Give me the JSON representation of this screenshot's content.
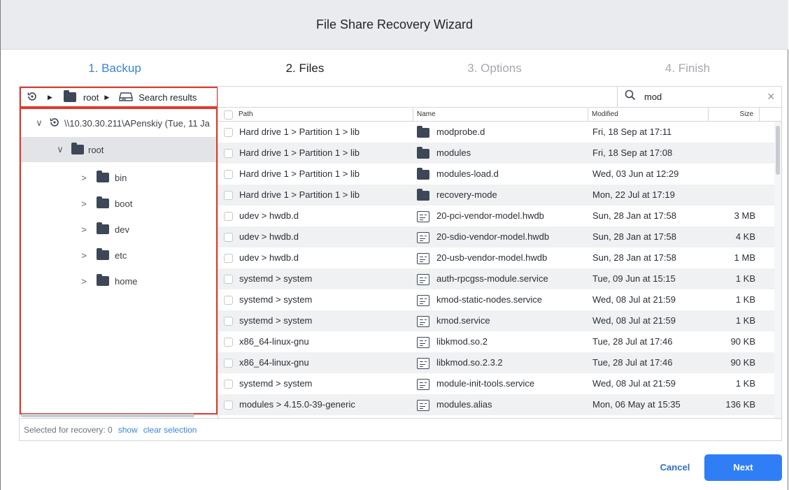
{
  "window": {
    "title": "File Share Recovery Wizard"
  },
  "steps": [
    {
      "label": "1. Backup",
      "state": "done"
    },
    {
      "label": "2. Files",
      "state": "current"
    },
    {
      "label": "3. Options",
      "state": "upcoming"
    },
    {
      "label": "4. Finish",
      "state": "upcoming"
    }
  ],
  "breadcrumb": {
    "items": [
      "root",
      "Search results"
    ],
    "icons": [
      "backup-restore-icon",
      "folder-icon",
      "drive-icon"
    ]
  },
  "tree": {
    "root_label": "\\\\10.30.30.211\\APenskiy (Tue, 11 Ja",
    "selected": "root",
    "root_folder": "root",
    "children": [
      "bin",
      "boot",
      "dev",
      "etc",
      "home"
    ]
  },
  "search": {
    "value": "mod",
    "icon": "search-icon",
    "clear_icon": "close-icon"
  },
  "table": {
    "columns": [
      "Path",
      "Name",
      "Modified",
      "Size"
    ],
    "rows": [
      {
        "path": "Hard drive 1 > Partition 1 > lib",
        "name": "modprobe.d",
        "type": "folder",
        "modified": "Fri, 18 Sep at 17:11",
        "size": ""
      },
      {
        "path": "Hard drive 1 > Partition 1 > lib",
        "name": "modules",
        "type": "folder",
        "modified": "Fri, 18 Sep at 17:08",
        "size": ""
      },
      {
        "path": "Hard drive 1 > Partition 1 > lib",
        "name": "modules-load.d",
        "type": "folder",
        "modified": "Wed, 03 Jun at 12:29",
        "size": ""
      },
      {
        "path": "Hard drive 1 > Partition 1 > lib",
        "name": "recovery-mode",
        "type": "folder",
        "modified": "Mon, 22 Jul at 17:19",
        "size": ""
      },
      {
        "path": "udev > hwdb.d",
        "name": "20-pci-vendor-model.hwdb",
        "type": "file",
        "modified": "Sun, 28 Jan at 17:58",
        "size": "3 MB"
      },
      {
        "path": "udev > hwdb.d",
        "name": "20-sdio-vendor-model.hwdb",
        "type": "file",
        "modified": "Sun, 28 Jan at 17:58",
        "size": "4 KB"
      },
      {
        "path": "udev > hwdb.d",
        "name": "20-usb-vendor-model.hwdb",
        "type": "file",
        "modified": "Sun, 28 Jan at 17:58",
        "size": "1 MB"
      },
      {
        "path": "systemd > system",
        "name": "auth-rpcgss-module.service",
        "type": "file",
        "modified": "Tue, 09 Jun at 15:15",
        "size": "1 KB"
      },
      {
        "path": "systemd > system",
        "name": "kmod-static-nodes.service",
        "type": "file",
        "modified": "Wed, 08 Jul at 21:59",
        "size": "1 KB"
      },
      {
        "path": "systemd > system",
        "name": "kmod.service",
        "type": "file",
        "modified": "Wed, 08 Jul at 21:59",
        "size": "1 KB"
      },
      {
        "path": "x86_64-linux-gnu",
        "name": "libkmod.so.2",
        "type": "file",
        "modified": "Tue, 28 Jul at 17:46",
        "size": "90 KB"
      },
      {
        "path": "x86_64-linux-gnu",
        "name": "libkmod.so.2.3.2",
        "type": "file",
        "modified": "Tue, 28 Jul at 17:46",
        "size": "90 KB"
      },
      {
        "path": "systemd > system",
        "name": "module-init-tools.service",
        "type": "file",
        "modified": "Wed, 08 Jul at 21:59",
        "size": "1 KB"
      },
      {
        "path": "modules > 4.15.0-39-generic",
        "name": "modules.alias",
        "type": "file",
        "modified": "Mon, 06 May at 15:35",
        "size": "136 KB"
      }
    ]
  },
  "status": {
    "label": "Selected for recovery: 0",
    "show": "show",
    "clear": "clear selection"
  },
  "footer": {
    "cancel": "Cancel",
    "next": "Next"
  },
  "colors": {
    "accent": "#2f7ef5",
    "step_active": "#3a84d8",
    "highlight_border": "#e03a2d"
  }
}
